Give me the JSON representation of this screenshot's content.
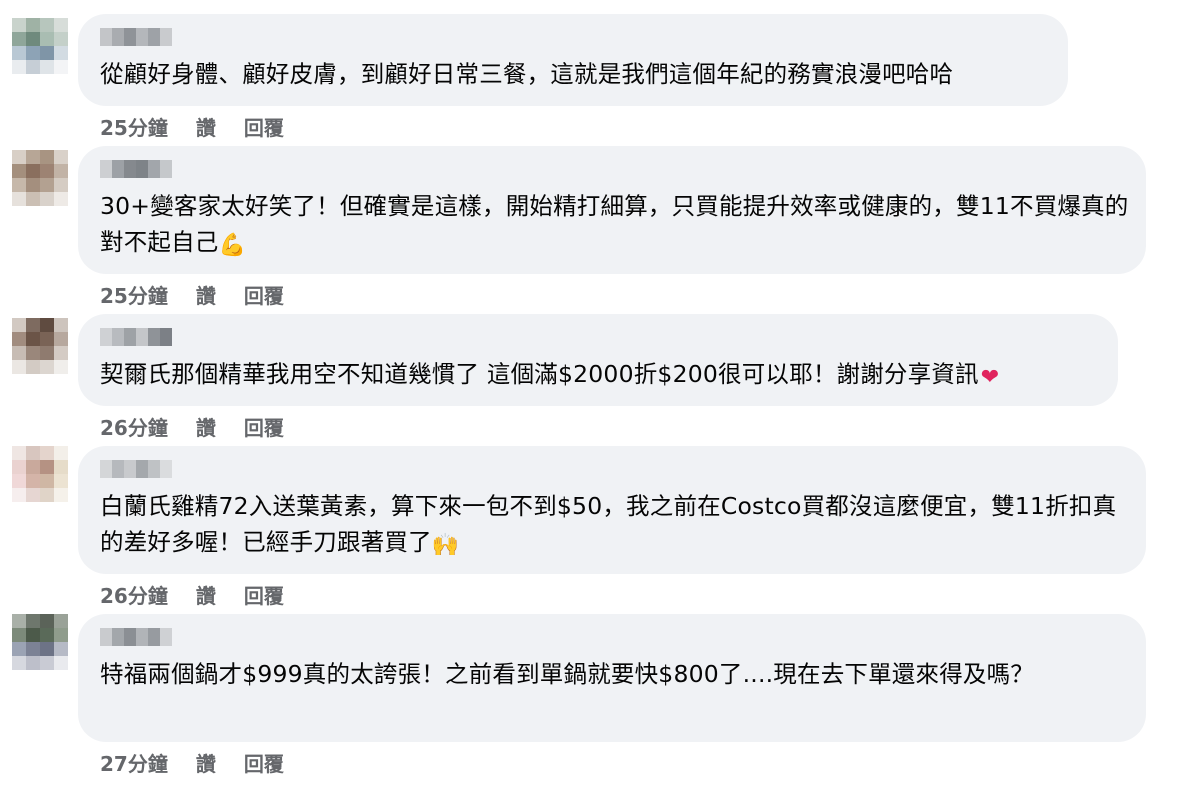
{
  "comments": [
    {
      "text": "從顧好身體、顧好皮膚，到顧好日常三餐，這就是我們這個年紀的務實浪漫吧哈哈",
      "emoji": "",
      "time": "25分鐘",
      "like_label": "讚",
      "reply_label": "回覆"
    },
    {
      "text": "30+變客家太好笑了！但確實是這樣，開始精打細算，只買能提升效率或健康的，雙11不買爆真的對不起自己",
      "emoji": "💪",
      "time": "25分鐘",
      "like_label": "讚",
      "reply_label": "回覆"
    },
    {
      "text": "契爾氏那個精華我用空不知道幾慣了 這個滿$2000折$200很可以耶！謝謝分享資訊",
      "emoji": "❤",
      "time": "26分鐘",
      "like_label": "讚",
      "reply_label": "回覆"
    },
    {
      "text": "白蘭氏雞精72入送葉黃素，算下來一包不到$50，我之前在Costco買都沒這麼便宜，雙11折扣真的差好多喔！已經手刀跟著買了",
      "emoji": "🙌",
      "time": "26分鐘",
      "like_label": "讚",
      "reply_label": "回覆"
    },
    {
      "text": "特福兩個鍋才$999真的太誇張！之前看到單鍋就要快$800了....現在去下單還來得及嗎？",
      "emoji": "",
      "time": "27分鐘",
      "like_label": "讚",
      "reply_label": "回覆"
    }
  ],
  "colors": {
    "bubble": "#f0f2f5",
    "meta_text": "#65676b",
    "body_text": "#050505",
    "heart": "#e0245e",
    "emoji_yellow": "#f5b82e"
  }
}
